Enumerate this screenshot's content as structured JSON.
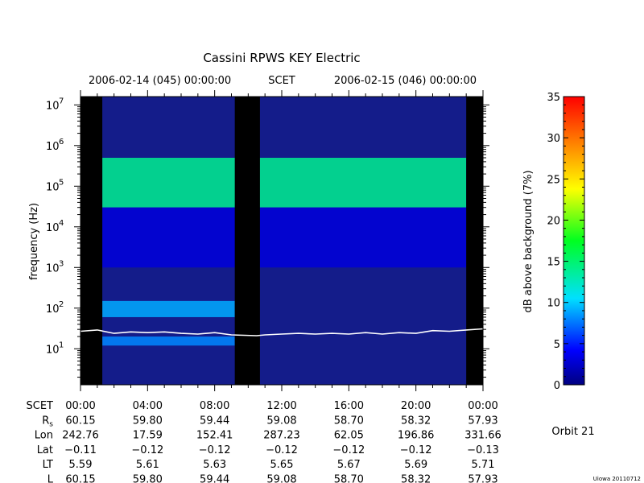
{
  "chart_data": {
    "type": "heatmap",
    "title": "Cassini RPWS KEY Electric",
    "time_header": {
      "start": "2006-02-14 (045) 00:00:00",
      "center": "SCET",
      "end": "2006-02-15 (046) 00:00:00"
    },
    "ylabel": "frequency (Hz)",
    "yscale": "log",
    "ylim": [
      1.3,
      16000000
    ],
    "y_ticks": [
      {
        "base": "10",
        "exp": "1",
        "value": 10
      },
      {
        "base": "10",
        "exp": "2",
        "value": 100
      },
      {
        "base": "10",
        "exp": "3",
        "value": 1000
      },
      {
        "base": "10",
        "exp": "4",
        "value": 10000
      },
      {
        "base": "10",
        "exp": "5",
        "value": 100000
      },
      {
        "base": "10",
        "exp": "6",
        "value": 1000000
      },
      {
        "base": "10",
        "exp": "7",
        "value": 10000000
      }
    ],
    "x_ticks": [
      "00:00",
      "04:00",
      "08:00",
      "12:00",
      "16:00",
      "20:00",
      "00:00"
    ],
    "xlim_hours": [
      0,
      24
    ],
    "colorbar": {
      "label": "dB above background (7%)",
      "range": [
        0,
        35
      ],
      "ticks": [
        "0",
        "5",
        "10",
        "15",
        "20",
        "25",
        "30",
        "35"
      ]
    },
    "data_gaps_hours": [
      [
        0,
        1.3
      ],
      [
        9.2,
        10.7
      ],
      [
        23.0,
        24.0
      ]
    ],
    "emission_bands": [
      {
        "f_low": 30000,
        "f_high": 500000,
        "level_db": 14,
        "t_start": 1.3,
        "t_end": 23.0
      },
      {
        "f_low": 60,
        "f_high": 150,
        "level_db": 9,
        "t_start": 1.3,
        "t_end": 9.2
      },
      {
        "f_low": 12,
        "f_high": 20,
        "level_db": 8,
        "t_start": 1.3,
        "t_end": 9.2
      },
      {
        "f_low": 1000,
        "f_high": 30000,
        "level_db": 3,
        "t_start": 1.3,
        "t_end": 23.0
      }
    ],
    "white_trace_hz": {
      "hours": [
        0.0,
        1.0,
        2.0,
        3.0,
        4.0,
        5.0,
        6.0,
        7.0,
        8.0,
        9.0,
        10.5,
        11.0,
        12.0,
        13.0,
        14.0,
        15.0,
        16.0,
        17.0,
        18.0,
        19.0,
        20.0,
        21.0,
        22.0,
        23.0,
        24.0
      ],
      "values": [
        27,
        29,
        24,
        26,
        25,
        26,
        24,
        23,
        25,
        22,
        21,
        22,
        23,
        24,
        23,
        24,
        23,
        25,
        23,
        25,
        24,
        28,
        27,
        29,
        31
      ]
    }
  },
  "ephemeris": {
    "rows": [
      {
        "label": "SCET",
        "values": [
          "00:00",
          "04:00",
          "08:00",
          "12:00",
          "16:00",
          "20:00",
          "00:00"
        ]
      },
      {
        "label": "Rs",
        "values": [
          "60.15",
          "59.80",
          "59.44",
          "59.08",
          "58.70",
          "58.32",
          "57.93"
        ]
      },
      {
        "label": "Lon",
        "values": [
          "242.76",
          "17.59",
          "152.41",
          "287.23",
          "62.05",
          "196.86",
          "331.66"
        ]
      },
      {
        "label": "Lat",
        "values": [
          "−0.11",
          "−0.12",
          "−0.12",
          "−0.12",
          "−0.12",
          "−0.12",
          "−0.13"
        ]
      },
      {
        "label": "LT",
        "values": [
          "5.59",
          "5.61",
          "5.63",
          "5.65",
          "5.67",
          "5.69",
          "5.71"
        ]
      },
      {
        "label": "L",
        "values": [
          "60.15",
          "59.80",
          "59.44",
          "59.08",
          "58.70",
          "58.32",
          "57.93"
        ]
      }
    ]
  },
  "orbit_label": "Orbit 21",
  "credit": "Uiowa 20110712",
  "colors": {
    "gap": "#000000",
    "background_low": "#101880",
    "trace": "#ffffff"
  }
}
